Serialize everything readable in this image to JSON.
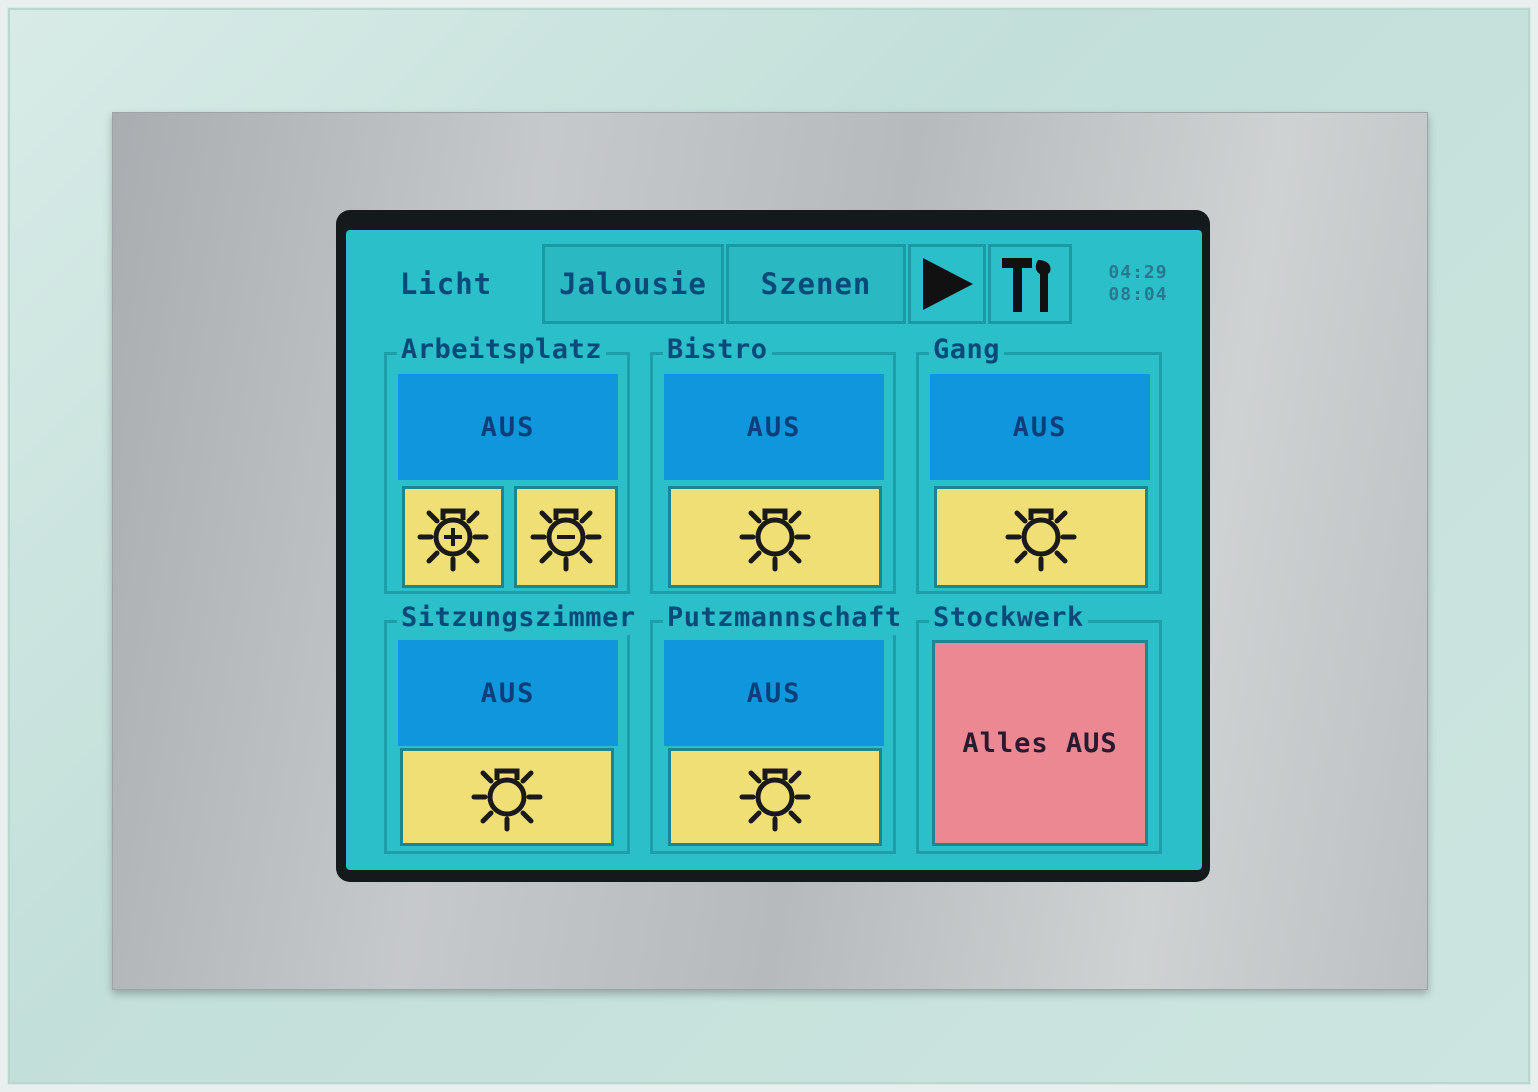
{
  "tabs": [
    {
      "label": "Licht",
      "active": true
    },
    {
      "label": "Jalousie",
      "active": false
    },
    {
      "label": "Szenen",
      "active": false
    }
  ],
  "icons": {
    "next": "play-arrow-icon",
    "tools": "hammer-wrench-icon"
  },
  "clock": {
    "line1": "04:29",
    "line2": "08:04"
  },
  "groups": [
    {
      "name": "Arbeitsplatz",
      "status": "AUS",
      "buttons": [
        "sun-plus-icon",
        "sun-minus-icon"
      ]
    },
    {
      "name": "Bistro",
      "status": "AUS",
      "buttons": [
        "sun-icon"
      ]
    },
    {
      "name": "Gang",
      "status": "AUS",
      "buttons": [
        "sun-icon"
      ]
    },
    {
      "name": "Sitzungszimmer",
      "status": "AUS",
      "buttons": [
        "sun-icon"
      ]
    },
    {
      "name": "Putzmannschaft",
      "status": "AUS",
      "buttons": [
        "sun-icon"
      ]
    },
    {
      "name": "Stockwerk",
      "action": "Alles AUS"
    }
  ],
  "colors": {
    "screen": "#2bbfc9",
    "status_off": "#0f96dd",
    "lamp_button": "#f0df74",
    "all_off_button": "#ec8892",
    "text": "#0a4a7a"
  }
}
